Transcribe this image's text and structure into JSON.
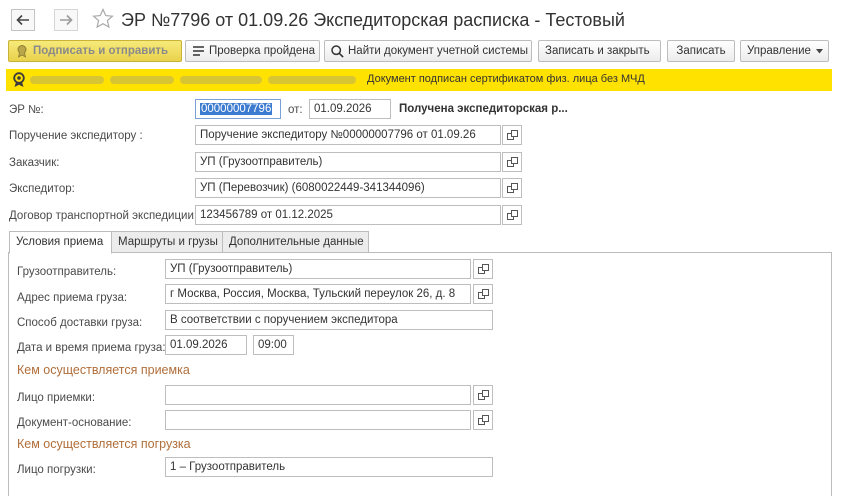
{
  "window": {
    "title": "ЭР №7796 от 01.09.26 Экспедиторская расписка - Тестовый"
  },
  "toolbar": {
    "sign_send": "Подписать и отправить",
    "check_passed": "Проверка пройдена",
    "find_doc": "Найти документ учетной системы",
    "save_close": "Записать и закрыть",
    "save": "Записать",
    "manage": "Управление"
  },
  "banner": {
    "message": "Документ подписан сертификатом физ. лица без МЧД"
  },
  "header": {
    "er_label": "ЭР №:",
    "er_number": "00000007796",
    "date_label": "от:",
    "date": "01.09.2026",
    "status": "Получена экспедиторская р...",
    "order_label": "Поручение экспедитору :",
    "order_value": "Поручение экспедитору №00000007796 от 01.09.26",
    "customer_label": "Заказчик:",
    "customer_value": "УП (Грузоотправитель)",
    "forwarder_label": "Экспедитор:",
    "forwarder_value": "УП (Перевозчик) (6080022449-341344096)",
    "contract_label": "Договор транспортной экспедиции:",
    "contract_value": "123456789 от 01.12.2025"
  },
  "tabs": [
    {
      "label": "Условия приема",
      "active": true
    },
    {
      "label": "Маршруты и грузы",
      "active": false
    },
    {
      "label": "Дополнительные данные",
      "active": false
    }
  ],
  "acceptance": {
    "shipper_label": "Грузоотправитель:",
    "shipper_value": "УП (Грузоотправитель)",
    "address_label": "Адрес приема груза:",
    "address_value": "г Москва, Россия, Москва, Тульский переулок 26, д. 8",
    "delivery_label": "Способ доставки груза:",
    "delivery_value": "В соответствии с поручением экспедитора",
    "datetime_label": "Дата и время приема груза:",
    "date_value": "01.09.2026",
    "time_value": "09:00",
    "section_accept": "Кем осуществляется приемка",
    "acceptor_label": "Лицо приемки:",
    "acceptor_value": "",
    "basis_label": "Документ-основание:",
    "basis_value": "",
    "section_load": "Кем осуществляется погрузка",
    "loader_label": "Лицо погрузки:",
    "loader_value": "1 – Грузоотправитель"
  }
}
